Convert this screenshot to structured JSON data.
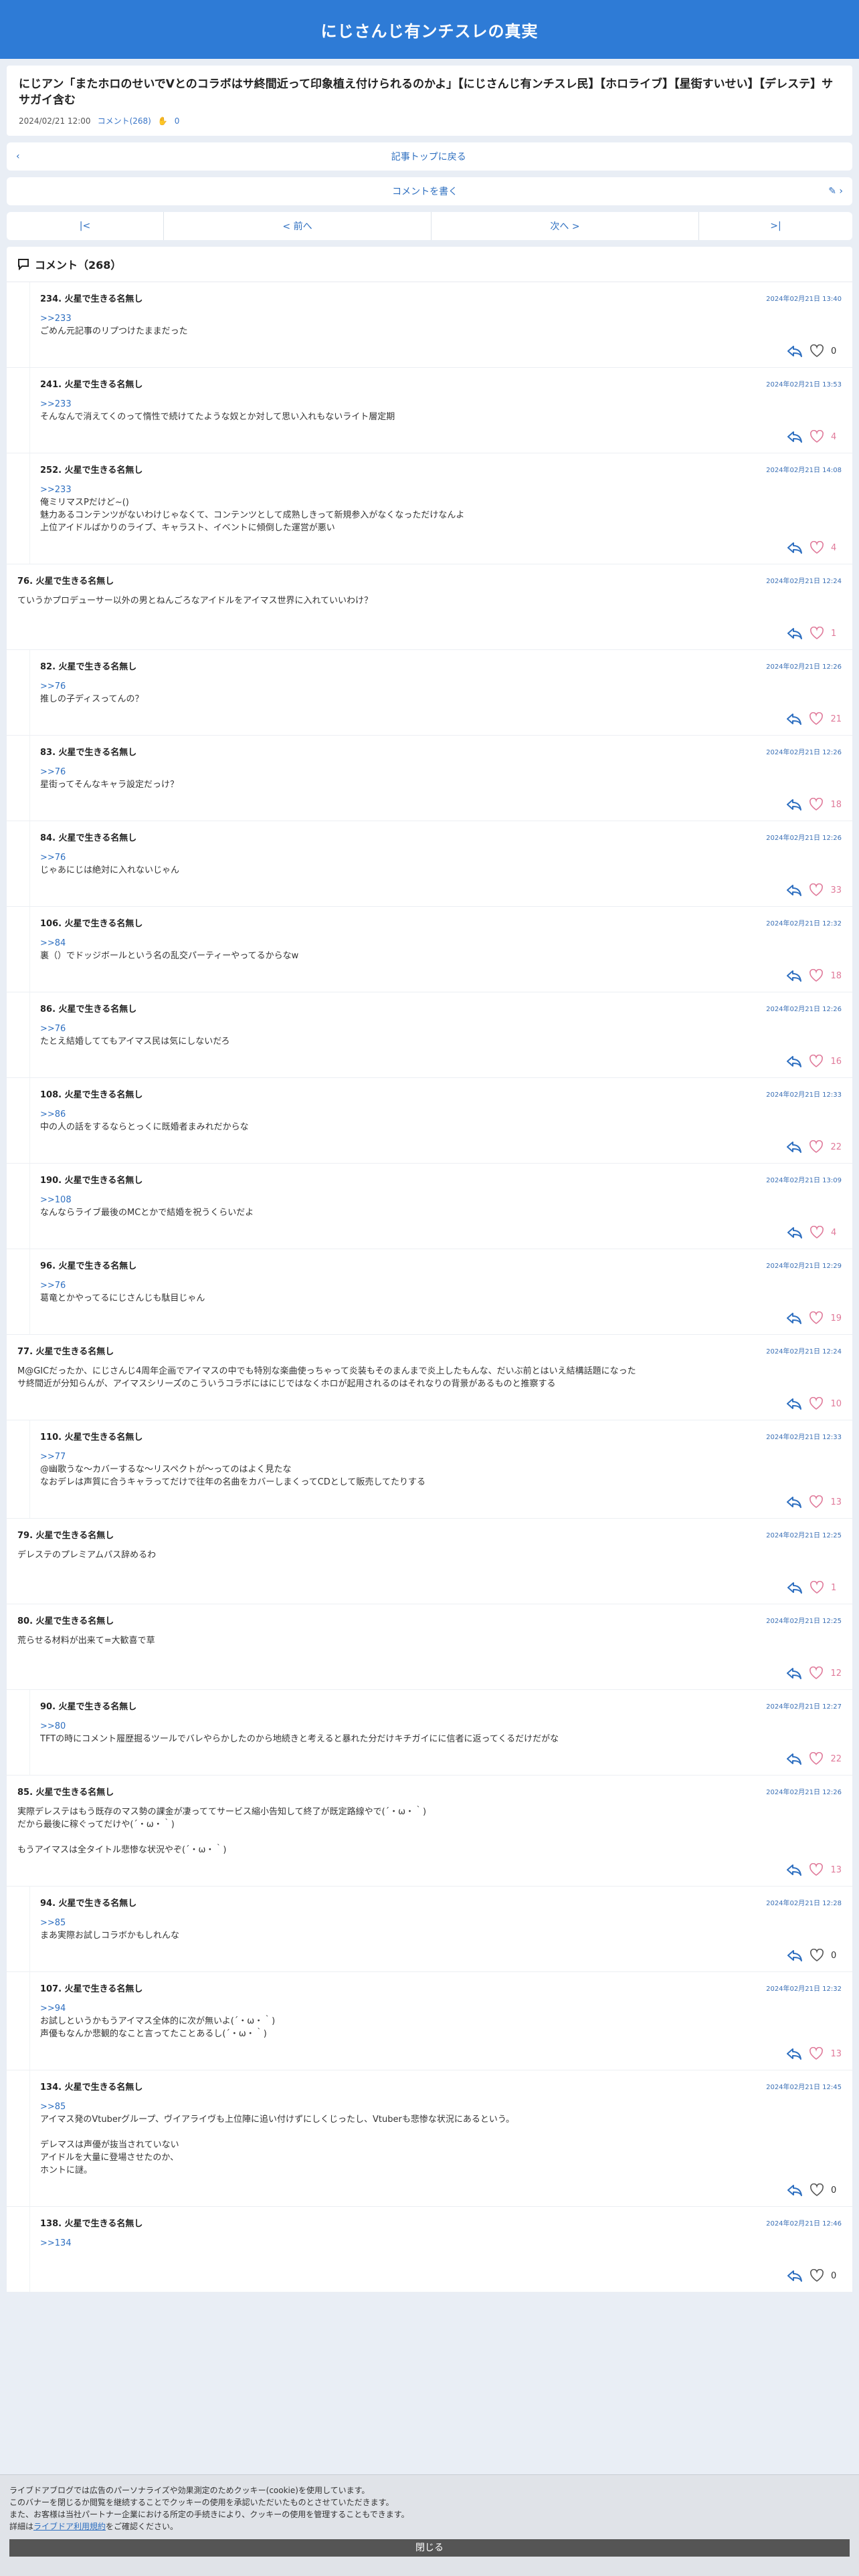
{
  "header": {
    "title": "にじさんじ有ンチスレの真実"
  },
  "article": {
    "title": "にじアン「またホロのせいでVとのコラボはサ終間近って印象植え付けられるのかよ」【にじさんじ有ンチスレ民】【ホロライブ】【星街すいせい】【デレステ】ササガイ含む",
    "date": "2024/02/21 12:00",
    "comments_link": "コメント(268)",
    "clap_count": "0"
  },
  "nav": {
    "back_label": "記事トップに戻る",
    "write_label": "コメントを書く"
  },
  "pager": {
    "first": "|<",
    "prev": "< 前へ",
    "next": "次へ >",
    "last": ">|"
  },
  "comments_header": {
    "title": "コメント（268）"
  },
  "comments": [
    {
      "name": "234. 火星で生きる名無し",
      "date": "2024年02月21日 13:40",
      "anchor": ">>233",
      "text": "ごめん元記事のリプつけたままだった",
      "likes": "0",
      "reply": true
    },
    {
      "name": "241. 火星で生きる名無し",
      "date": "2024年02月21日 13:53",
      "anchor": ">>233",
      "text": "そんなんで消えてくのって惰性で続けてたような奴とか対して思い入れもないライト層定期",
      "likes": "4",
      "reply": true
    },
    {
      "name": "252. 火星で生きる名無し",
      "date": "2024年02月21日 14:08",
      "anchor": ">>233",
      "text": "俺ミリマスPだけど~()\n魅力あるコンテンツがないわけじゃなくて、コンテンツとして成熟しきって新規参入がなくなっただけなんよ\n上位アイドルばかりのライブ、キャラスト、イベントに傾倒した運営が悪い",
      "likes": "4",
      "reply": true
    },
    {
      "name": "76. 火星で生きる名無し",
      "date": "2024年02月21日 12:24",
      "anchor": "",
      "text": "ていうかプロデューサー以外の男とねんごろなアイドルをアイマス世界に入れていいわけ？",
      "likes": "1",
      "reply": false
    },
    {
      "name": "82. 火星で生きる名無し",
      "date": "2024年02月21日 12:26",
      "anchor": ">>76",
      "text": "推しの子ディスってんの？",
      "likes": "21",
      "reply": true
    },
    {
      "name": "83. 火星で生きる名無し",
      "date": "2024年02月21日 12:26",
      "anchor": ">>76",
      "text": "星街ってそんなキャラ設定だっけ？",
      "likes": "18",
      "reply": true
    },
    {
      "name": "84. 火星で生きる名無し",
      "date": "2024年02月21日 12:26",
      "anchor": ">>76",
      "text": "じゃあにじは絶対に入れないじゃん",
      "likes": "33",
      "reply": true
    },
    {
      "name": "106. 火星で生きる名無し",
      "date": "2024年02月21日 12:32",
      "anchor": ">>84",
      "text": "裏（）でドッジボールという名の乱交パーティーやってるからなw",
      "likes": "18",
      "reply": true
    },
    {
      "name": "86. 火星で生きる名無し",
      "date": "2024年02月21日 12:26",
      "anchor": ">>76",
      "text": "たとえ結婚しててもアイマス民は気にしないだろ",
      "likes": "16",
      "reply": true
    },
    {
      "name": "108. 火星で生きる名無し",
      "date": "2024年02月21日 12:33",
      "anchor": ">>86",
      "text": "中の人の話をするならとっくに既婚者まみれだからな",
      "likes": "22",
      "reply": true
    },
    {
      "name": "190. 火星で生きる名無し",
      "date": "2024年02月21日 13:09",
      "anchor": ">>108",
      "text": "なんならライブ最後のMCとかで結婚を祝うくらいだよ",
      "likes": "4",
      "reply": true
    },
    {
      "name": "96. 火星で生きる名無し",
      "date": "2024年02月21日 12:29",
      "anchor": ">>76",
      "text": "葛竜とかやってるにじさんじも駄目じゃん",
      "likes": "19",
      "reply": true
    },
    {
      "name": "77. 火星で生きる名無し",
      "date": "2024年02月21日 12:24",
      "anchor": "",
      "text": "M@GICだったか、にじさんじ4周年企画でアイマスの中でも特別な楽曲使っちゃって炎装もそのまんまで炎上したもんな、だいぶ前とはいえ結構話題になった\nサ終間近が分知らんが、アイマスシリーズのこういうコラボにはにじではなくホロが起用されるのはそれなりの背景があるものと推察する",
      "likes": "10",
      "reply": false
    },
    {
      "name": "110. 火星で生きる名無し",
      "date": "2024年02月21日 12:33",
      "anchor": ">>77",
      "text": "@幽歌うな〜カバーするな〜リスペクトが〜ってのはよく見たな\nなおデレは声質に合うキャラってだけで往年の名曲をカバーしまくってCDとして販売してたりする",
      "likes": "13",
      "reply": true
    },
    {
      "name": "79. 火星で生きる名無し",
      "date": "2024年02月21日 12:25",
      "anchor": "",
      "text": "デレステのプレミアムパス辞めるわ",
      "likes": "1",
      "reply": false
    },
    {
      "name": "80. 火星で生きる名無し",
      "date": "2024年02月21日 12:25",
      "anchor": "",
      "text": "荒らせる材料が出来て=大歓喜で草",
      "likes": "12",
      "reply": false
    },
    {
      "name": "90. 火星で生きる名無し",
      "date": "2024年02月21日 12:27",
      "anchor": ">>80",
      "text": "TFTの時にコメント履歴掘るツールでバレやらかしたのから地続きと考えると暴れた分だけキチガイにに信者に返ってくるだけだがな",
      "likes": "22",
      "reply": true
    },
    {
      "name": "85. 火星で生きる名無し",
      "date": "2024年02月21日 12:26",
      "anchor": "",
      "text": "実際デレステはもう既存のマス勢の課金が凄っててサービス縮小告知して終了が既定路線やで(´・ω・｀)\nだから最後に稼ぐってだけや(´・ω・｀)\n\nもうアイマスは全タイトル悲惨な状況やぞ(´・ω・｀)",
      "likes": "13",
      "reply": false
    },
    {
      "name": "94. 火星で生きる名無し",
      "date": "2024年02月21日 12:28",
      "anchor": ">>85",
      "text": "まあ実際お試しコラボかもしれんな",
      "likes": "0",
      "reply": true
    },
    {
      "name": "107. 火星で生きる名無し",
      "date": "2024年02月21日 12:32",
      "anchor": ">>94",
      "text": "お試しというかもうアイマス全体的に次が無いよ(´・ω・｀)\n声優もなんか悲観的なこと言ってたことあるし(´・ω・｀)",
      "likes": "13",
      "reply": true
    },
    {
      "name": "134. 火星で生きる名無し",
      "date": "2024年02月21日 12:45",
      "anchor": ">>85",
      "text": "アイマス発のVtuberグループ、ヴイアライヴも上位陣に追い付けずにしくじったし、Vtuberも悲惨な状況にあるという。\n\nデレマスは声優が抜当されていない\nアイドルを大量に登場させたのか、\nホントに謎。",
      "likes": "0",
      "reply": true
    },
    {
      "name": "138. 火星で生きる名無し",
      "date": "2024年02月21日 12:46",
      "anchor": ">>134",
      "text": "",
      "likes": "0",
      "reply": true
    }
  ],
  "cookie": {
    "line1": "ライブドアブログでは広告のパーソナライズや効果測定のためクッキー(cookie)を使用しています。",
    "line2": "このバナーを閉じるか閲覧を継続することでクッキーの使用を承認いただいたものとさせていただきます。",
    "line3": "また、お客様は当社パートナー企業における所定の手続きにより、クッキーの使用を管理することもできます。",
    "line4_prefix": "詳細は",
    "line4_link": "ライブドア利用規約",
    "line4_suffix": "をご確認ください。",
    "close_label": "閉じる"
  },
  "colors": {
    "accent": "#2e7bd6",
    "heart": "#e07a9a",
    "link": "#2e6fc0"
  }
}
